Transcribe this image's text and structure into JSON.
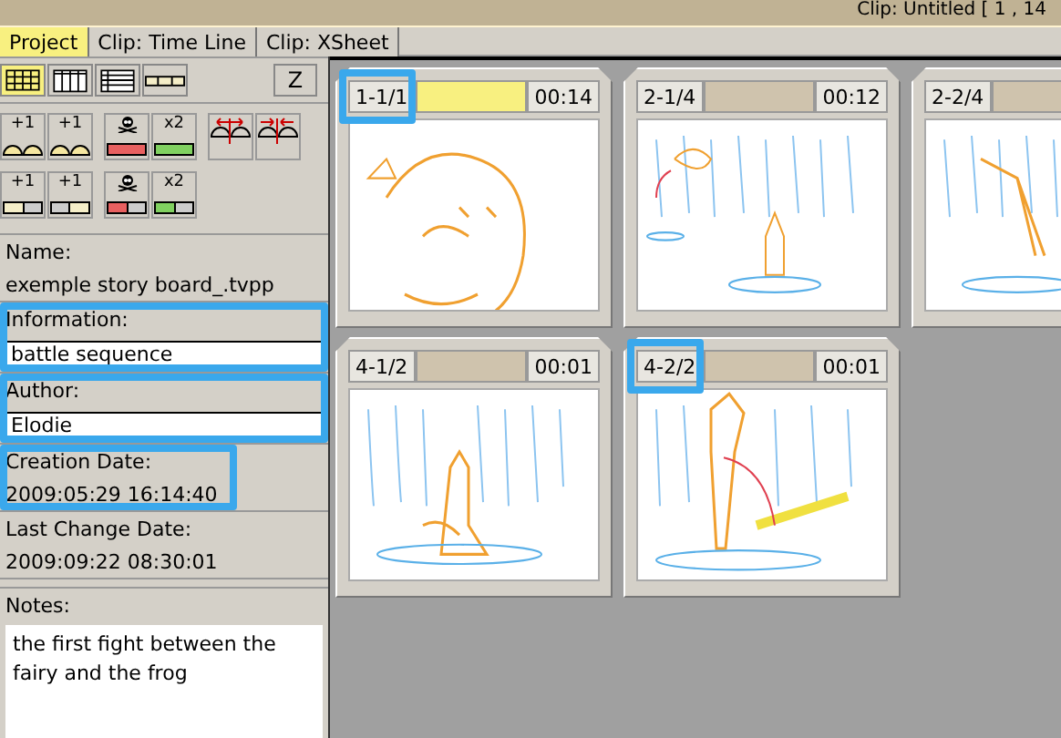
{
  "title_bar": {
    "text": "Clip: Untitled [ 1 , 14"
  },
  "tabs": [
    {
      "label": "Project",
      "selected": true
    },
    {
      "label": "Clip: Time Line",
      "selected": false
    },
    {
      "label": "Clip: XSheet",
      "selected": false
    }
  ],
  "view_buttons": [
    {
      "kind": "grid",
      "selected": true
    },
    {
      "kind": "columns",
      "selected": false
    },
    {
      "kind": "rows",
      "selected": false
    },
    {
      "kind": "strip",
      "selected": false
    }
  ],
  "zoom_button": "Z",
  "tool_rows": [
    [
      {
        "kind": "addleft",
        "label": "+1"
      },
      {
        "kind": "addright",
        "label": "+1"
      },
      {
        "kind": "delete"
      },
      {
        "kind": "double",
        "label": "x2"
      },
      {
        "kind": "split"
      },
      {
        "kind": "merge"
      }
    ],
    [
      {
        "kind": "addleft",
        "label": "+1"
      },
      {
        "kind": "addright",
        "label": "+1"
      },
      {
        "kind": "delete"
      },
      {
        "kind": "double",
        "label": "x2"
      }
    ]
  ],
  "fields": [
    {
      "label": "Name:",
      "value": "exemple story board_.tvpp",
      "kind": "text",
      "highlighted": false
    },
    {
      "label": "Information:",
      "value": "battle sequence",
      "kind": "input",
      "highlighted": true
    },
    {
      "label": "Author:",
      "value": "Elodie",
      "kind": "input",
      "highlighted": true
    },
    {
      "label": "Creation Date:",
      "value": "2009:05:29 16:14:40",
      "kind": "text",
      "highlighted": true
    },
    {
      "label": "Last Change Date:",
      "value": "2009:09:22 08:30:01",
      "kind": "text",
      "highlighted": false
    }
  ],
  "notes": {
    "label": "Notes:",
    "value": "the first fight between the fairy and the frog"
  },
  "card_rows": [
    [
      {
        "label": "1-1/1",
        "duration": "00:14",
        "selected": true,
        "highlighted": true
      },
      {
        "label": "2-1/4",
        "duration": "00:12",
        "selected": false,
        "highlighted": false
      },
      {
        "label": "2-2/4",
        "selected": false,
        "highlighted": false
      }
    ],
    [
      {
        "label": "4-1/2",
        "duration": "00:01",
        "selected": false,
        "highlighted": false
      },
      {
        "label": "4-2/2",
        "duration": "00:01",
        "selected": false,
        "highlighted": true
      }
    ]
  ]
}
